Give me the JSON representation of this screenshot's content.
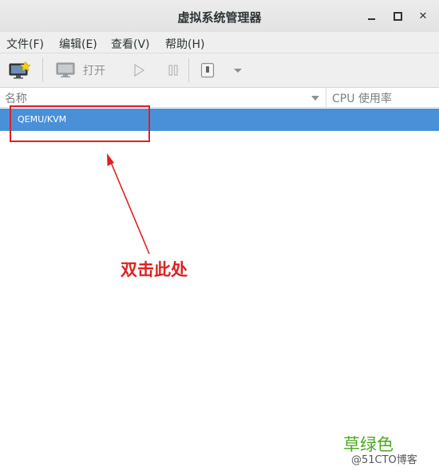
{
  "window": {
    "title": "虚拟系统管理器",
    "minimize_glyph": "_",
    "close_glyph": "✕"
  },
  "menu": {
    "file": "文件(F)",
    "edit": "编辑(E)",
    "view": "查看(V)",
    "help": "帮助(H)"
  },
  "toolbar": {
    "open_label": "打开",
    "new_vm_icon": "monitor-star-icon",
    "open_icon": "monitor-icon",
    "run_icon": "play-icon",
    "pause_icon": "pause-icon",
    "shutdown_icon": "power-icon",
    "dropdown_icon": "chevron-down-icon"
  },
  "table": {
    "columns": {
      "name": "名称",
      "cpu": "CPU 使用率"
    },
    "rows": [
      {
        "label": "QEMU/KVM",
        "selected": true
      }
    ]
  },
  "annotation": {
    "text": "双击此处",
    "color": "#e02020"
  },
  "watermark": {
    "green_text": "草绿色",
    "site_text": "@51CTO博客"
  },
  "colors": {
    "selection": "#4a90d9",
    "annotation_red": "#e02020",
    "watermark_green": "#4ca81f"
  }
}
